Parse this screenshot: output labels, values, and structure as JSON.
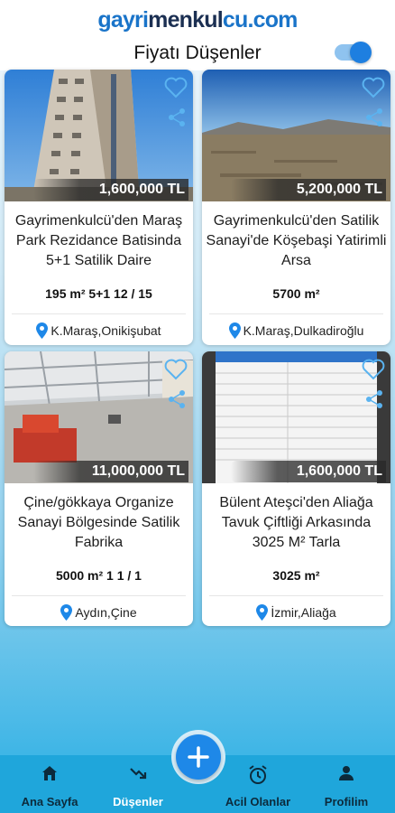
{
  "header": {
    "logo_part1": "gayri",
    "logo_part2": "menkul",
    "logo_part3": "cu.com",
    "title": "Fiyatı Düşenler",
    "toggle_on": true
  },
  "listings": [
    {
      "price": "1,600,000 TL",
      "title": "Gayrimenkulcü'den Maraş Park Rezidance Batisinda 5+1 Satilik Daire",
      "specs": "195 m²  5+1  12 / 15",
      "location": "K.Maraş,Onikişubat"
    },
    {
      "price": "5,200,000 TL",
      "title": "Gayrimenkulcü'den Satilik Sanayi'de Köşebaşi Yatirimli Arsa",
      "specs": "5700 m²",
      "location": "K.Maraş,Dulkadiroğlu"
    },
    {
      "price": "11,000,000 TL",
      "title": "Çine/gökkaya Organize Sanayi Bölgesinde Satilik Fabrika",
      "specs": "5000 m²  1  1 / 1",
      "location": "Aydın,Çine"
    },
    {
      "price": "1,600,000 TL",
      "title": "Bülent Ateşci'den Aliağa Tavuk Çiftliği Arkasında 3025 M² Tarla",
      "specs": "3025 m²",
      "location": "İzmir,Aliağa"
    }
  ],
  "nav": {
    "home": "Ana Sayfa",
    "dropped": "Düşenler",
    "urgent": "Acil Olanlar",
    "profile": "Profilim"
  },
  "colors": {
    "accent": "#1e88e8",
    "nav_bg": "#1fa6db",
    "pin": "#1e88e8"
  }
}
